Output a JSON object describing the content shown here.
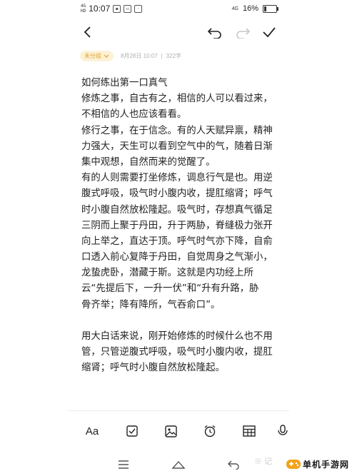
{
  "status_bar": {
    "signal1": "4G",
    "signal2": "HD",
    "time": "10:07",
    "network": "4G",
    "battery": "16%",
    "battery_level": 0.16
  },
  "toolbar": {
    "back_icon": "chevron-left-icon",
    "undo_icon": "undo-icon",
    "redo_icon": "redo-icon",
    "done_icon": "check-icon"
  },
  "meta": {
    "category": "未分组",
    "date": "8月28日 10:07",
    "separator": "|",
    "char_count": "322字"
  },
  "note": {
    "lines": [
      "如何练出第一口真气",
      "修炼之事，自古有之，相信的人可以看过来，",
      "不相信的人也应该看看。",
      "修行之事，在于信念。有的人天赋异禀，精神",
      "力强大，天生可以看到空气中的气，随着日渐",
      "集中观想，自然而来的觉醒了。",
      "有的人则需要打坐修炼，调息行气是也。用逆",
      "腹式呼吸，吸气时小腹内收，提肛缩肾；呼气",
      "时小腹自然放松隆起。吸气时，存想真气循足",
      "三阴而上聚于丹田，升于两胁，脊缝极力张开",
      "向上举之，直达于顶。呼气时气亦下降，自俞",
      "口透入前心复降于丹田，自觉周身之气渐小，",
      "龙蛰虎卧，潜藏于斯。这就是内功经上所",
      "云“先提后下，一升一伏”和“升有升路，胁",
      "骨齐举；降有降所，气吞俞口”。",
      "",
      "用大白话来说，刚开始修炼的时候什么也不用",
      "管，只管逆腹式呼吸，吸气时小腹内收，提肛",
      "缩肾；呼气时小腹自然放松隆起。"
    ]
  },
  "edit_bar": {
    "text_format_label": "Aa",
    "checklist_icon": "checkbox-icon",
    "image_icon": "image-icon",
    "alarm_icon": "alarm-clock-icon",
    "table_icon": "table-icon",
    "voice_icon": "voice-icon"
  },
  "nav_bar": {
    "menu_icon": "menu-icon",
    "home_icon": "home-icon",
    "back_icon": "back-icon"
  },
  "watermarks": {
    "left": "※ 记",
    "right": "单机手游网"
  }
}
